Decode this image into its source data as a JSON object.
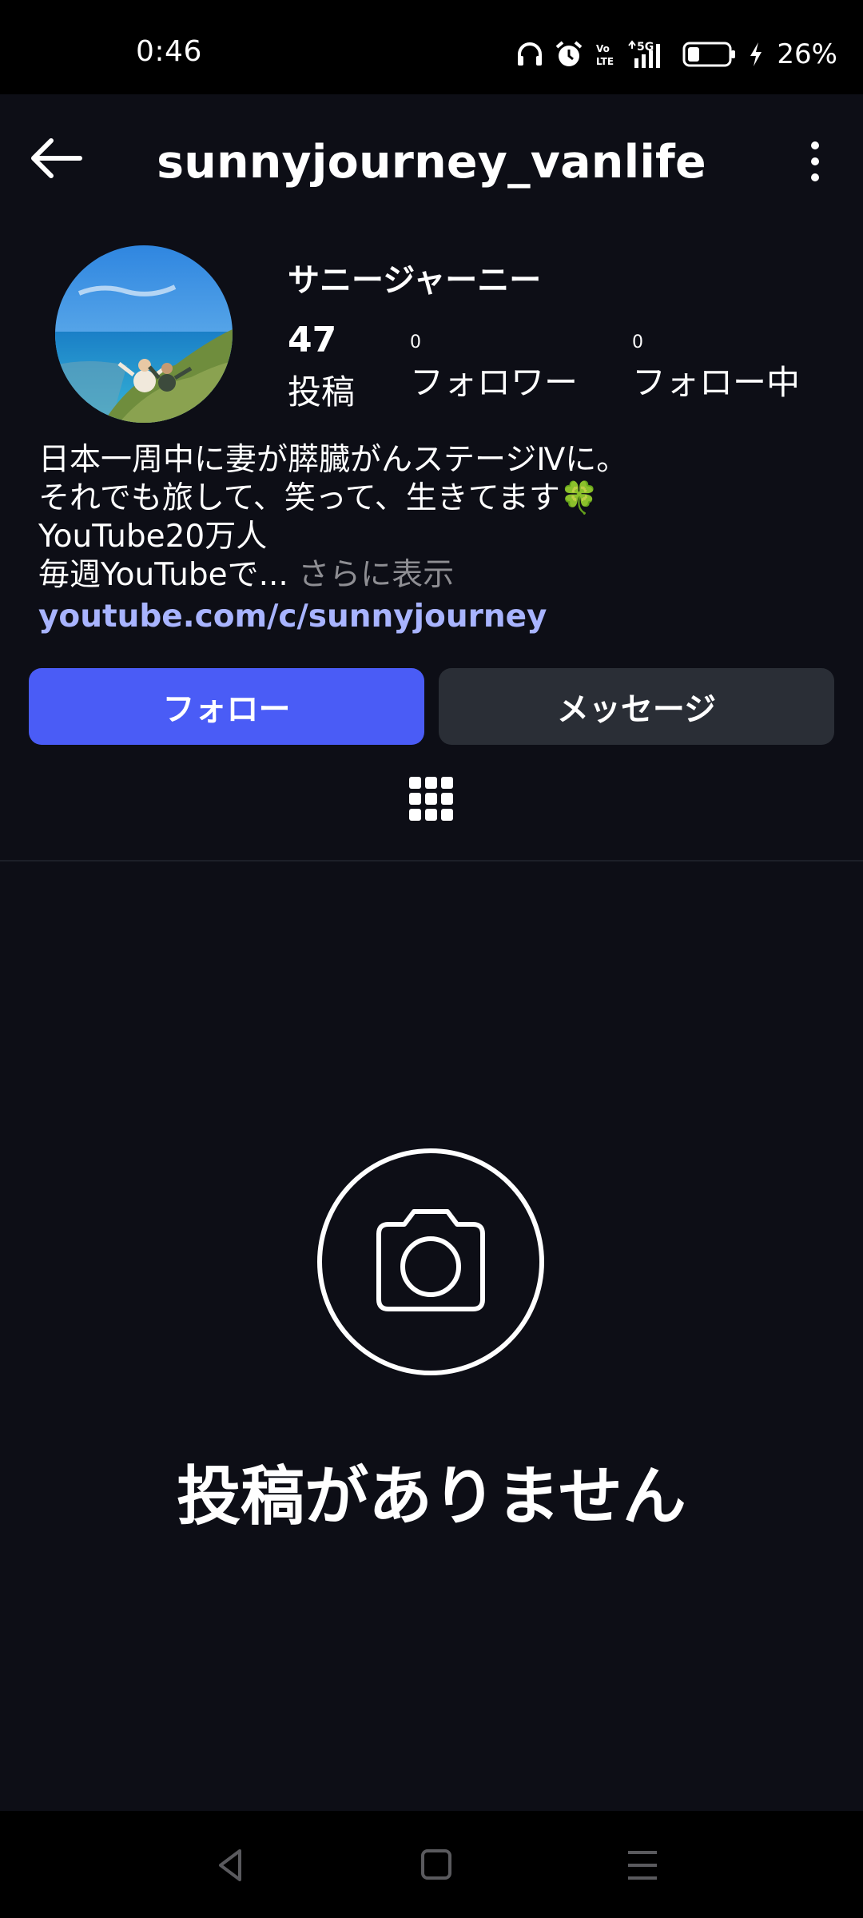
{
  "status_bar": {
    "time": "0:46",
    "battery": "26%",
    "network": "5G",
    "icons": [
      "headphones-icon",
      "alarm-icon",
      "volte-icon",
      "signal-icon",
      "battery-icon",
      "charging-icon"
    ]
  },
  "header": {
    "username": "sunnyjourney_vanlife",
    "back_icon": "arrow-left-icon",
    "more_icon": "more-vertical-icon"
  },
  "profile": {
    "display_name": "サニージャーニー",
    "posts_count": "47",
    "posts_label": "投稿",
    "followers_count": "0",
    "followers_label": "フォロワー",
    "following_count": "0",
    "following_label": "フォロー中"
  },
  "bio": {
    "line1": "日本一周中に妻が膵臓がんステージⅣに。",
    "line2": "それでも旅して、笑って、生きてます🍀",
    "line3": "YouTube20万人",
    "line4": "毎週YouTubeで...",
    "more": " さらに表示",
    "link": "youtube.com/c/sunnyjourney"
  },
  "buttons": {
    "follow": "フォロー",
    "message": "メッセージ"
  },
  "tabs": {
    "grid_icon": "grid-icon"
  },
  "empty_state": {
    "icon": "camera-icon",
    "text": "投稿がありません"
  },
  "nav_bar": {
    "items": [
      "nav-back-icon",
      "nav-home-icon",
      "nav-menu-icon"
    ]
  },
  "colors": {
    "background": "#0d0e16",
    "accent": "#4a5cf6",
    "link": "#a8b4ff",
    "secondary_button": "#2a2e36"
  }
}
